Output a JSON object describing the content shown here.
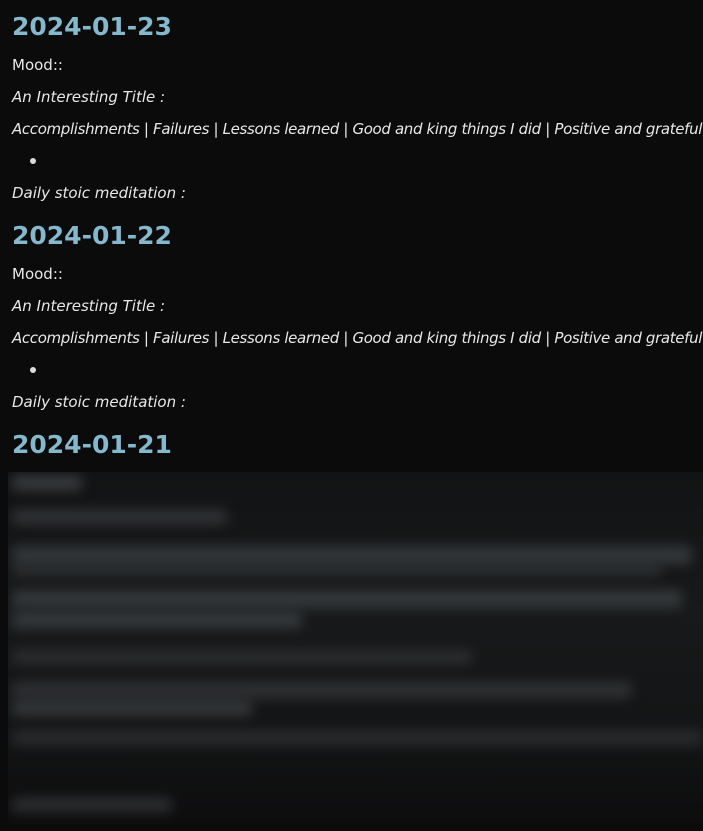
{
  "entries": [
    {
      "date": "2024-01-23",
      "mood_label": "Mood::",
      "title_label": "An Interesting Title :",
      "sections_label": "Accomplishments | Failures | Lessons learned | Good and king things I did | Positive and grateful for :",
      "stoic_label": "Daily stoic meditation :"
    },
    {
      "date": "2024-01-22",
      "mood_label": "Mood::",
      "title_label": "An Interesting Title :",
      "sections_label": "Accomplishments | Failures | Lessons learned | Good and king things I did | Positive and grateful for :",
      "stoic_label": "Daily stoic meditation :"
    },
    {
      "date": "2024-01-21"
    }
  ],
  "colors": {
    "background": "#0b0b0c",
    "heading": "#85b8cc",
    "text": "#e8e8e8"
  }
}
